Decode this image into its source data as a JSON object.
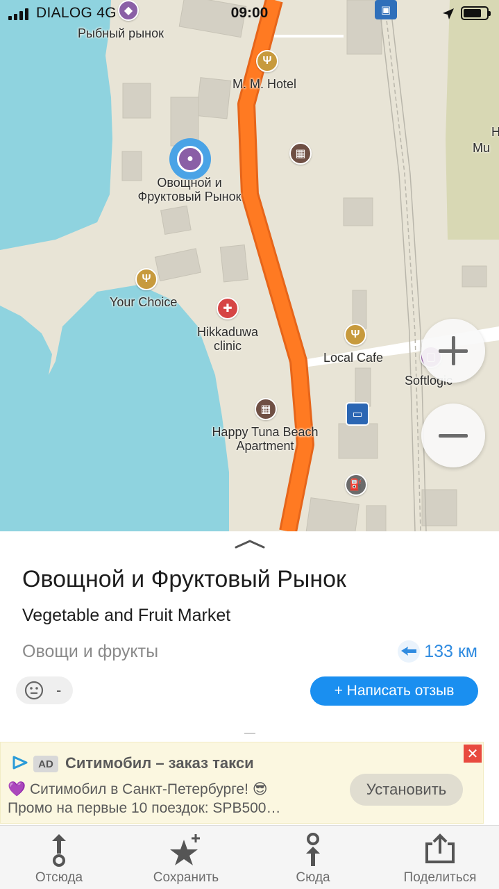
{
  "status_bar": {
    "carrier": "DIALOG 4G",
    "time": "09:00"
  },
  "map": {
    "labels": {
      "fish_market": "Рыбный рынок",
      "mm_hotel": "M. M. Hotel",
      "veg_market_line1": "Овощной и",
      "veg_market_line2": "Фруктовый Рынок",
      "your_choice": "Your Choice",
      "clinic_line1": "Hikkaduwa",
      "clinic_line2": "clinic",
      "local_cafe": "Local Cafe",
      "softlogic": "Softlogic",
      "happy_tuna_line1": "Happy Tuna Beach",
      "happy_tuna_line2": "Apartment",
      "edge_partial_1": "H",
      "edge_partial_2": "Mu"
    },
    "colors": {
      "water": "#8fd3df",
      "land": "#e8e4d6",
      "road": "#ff7a22",
      "park": "#d8d8b4",
      "building": "#d4d0c4"
    }
  },
  "place": {
    "title": "Овощной и Фруктовый Рынок",
    "subtitle": "Vegetable and Fruit Market",
    "category": "Овощи и фрукты",
    "distance": "133 км",
    "rating": "-",
    "review_button": "+ Написать отзыв"
  },
  "ad": {
    "badge": "AD",
    "title": "Ситимобил – заказ такси",
    "line1": "💜 Ситимобил в Санкт-Петербурге! 😎",
    "line2": "Промо на первые 10 поездок: SPB500…",
    "install": "Установить",
    "close": "✕"
  },
  "tabbar": {
    "from": "Отсюда",
    "save": "Сохранить",
    "to": "Сюда",
    "share": "Поделиться"
  }
}
